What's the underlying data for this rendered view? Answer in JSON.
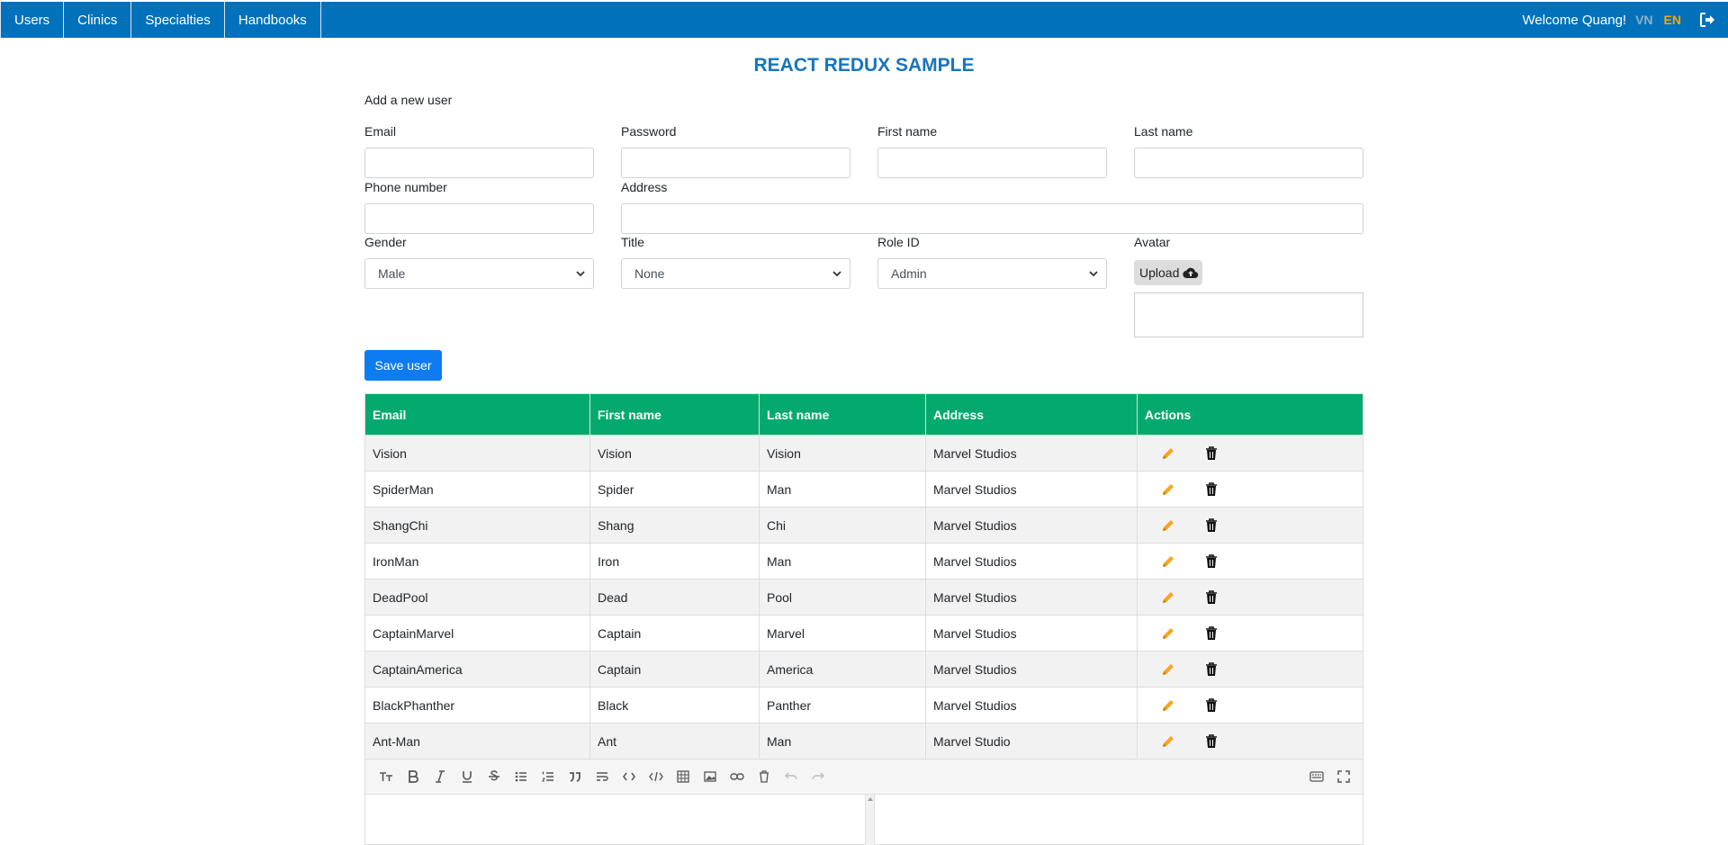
{
  "nav": {
    "items": [
      "Users",
      "Clinics",
      "Specialties",
      "Handbooks"
    ],
    "welcome": "Welcome Quang!",
    "lang_vn": "VN",
    "lang_en": "EN"
  },
  "page": {
    "title": "REACT REDUX SAMPLE",
    "subheading": "Add a new user"
  },
  "form": {
    "email_label": "Email",
    "password_label": "Password",
    "first_name_label": "First name",
    "last_name_label": "Last name",
    "phone_label": "Phone number",
    "address_label": "Address",
    "gender_label": "Gender",
    "gender_value": "Male",
    "title_label": "Title",
    "title_value": "None",
    "role_label": "Role ID",
    "role_value": "Admin",
    "avatar_label": "Avatar",
    "upload_label": "Upload",
    "save_label": "Save user"
  },
  "table": {
    "headers": [
      "Email",
      "First name",
      "Last name",
      "Address",
      "Actions"
    ],
    "rows": [
      [
        "Vision",
        "Vision",
        "Vision",
        "Marvel Studios"
      ],
      [
        "SpiderMan",
        "Spider",
        "Man",
        "Marvel Studios"
      ],
      [
        "ShangChi",
        "Shang",
        "Chi",
        "Marvel Studios"
      ],
      [
        "IronMan",
        "Iron",
        "Man",
        "Marvel Studios"
      ],
      [
        "DeadPool",
        "Dead",
        "Pool",
        "Marvel Studios"
      ],
      [
        "CaptainMarvel",
        "Captain",
        "Marvel",
        "Marvel Studios"
      ],
      [
        "CaptainAmerica",
        "Captain",
        "America",
        "Marvel Studios"
      ],
      [
        "BlackPhanther",
        "Black",
        "Panther",
        "Marvel Studios"
      ],
      [
        "Ant-Man",
        "Ant",
        "Man",
        "Marvel Studio"
      ]
    ]
  },
  "colors": {
    "nav_bg": "#0071ba",
    "title": "#1775be",
    "table_header": "#04aa6d",
    "save_button": "#0d7cf2",
    "edit_icon": "#f5a623",
    "lang_active": "#f7a600"
  },
  "icons": {
    "logout": "sign-out-icon",
    "upload": "cloud-upload-icon",
    "edit": "pencil-icon",
    "delete": "trash-icon"
  }
}
